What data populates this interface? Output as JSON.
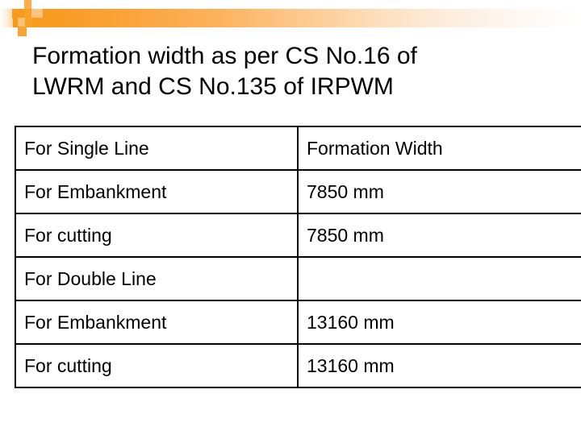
{
  "slide": {
    "title": "Formation width as per CS No.16 of\nLWRM and CS No.135 of IRPWM",
    "background_color": "#ffffff",
    "accent_color": "#f79a1e",
    "text_color": "#000000"
  },
  "decor": {
    "bar_name": "orange-gradient-bar",
    "squares": [
      "accent-square-1",
      "accent-square-2",
      "accent-square-3",
      "accent-square-4",
      "accent-tall-bar"
    ]
  },
  "table": {
    "columns": [
      "For Single Line",
      "Formation Width"
    ],
    "rows": [
      {
        "label": "For Single Line",
        "value": "Formation Width",
        "header": true
      },
      {
        "label": "For Embankment",
        "value": "7850 mm",
        "header": false
      },
      {
        "label": "For cutting",
        "value": "7850 mm",
        "header": false
      },
      {
        "label": "For Double Line",
        "value": "",
        "header": false
      },
      {
        "label": "For Embankment",
        "value": "13160 mm",
        "header": false
      },
      {
        "label": "For cutting",
        "value": "13160 mm",
        "header": false
      }
    ]
  }
}
